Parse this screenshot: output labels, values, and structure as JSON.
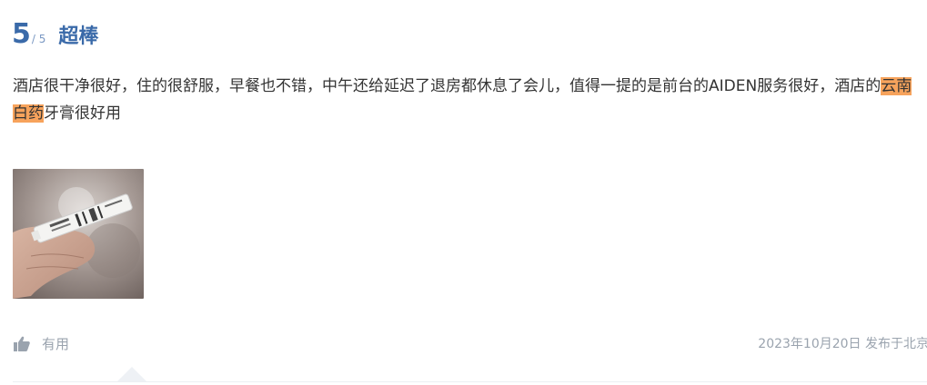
{
  "review": {
    "score": "5",
    "score_max": "/ 5",
    "title": "超棒",
    "text_before": "酒店很干净很好，住的很舒服，早餐也不错，中午还给延迟了退房都休息了会儿，值得一提的是前台的AIDEN服务很好，酒店的",
    "text_highlight": "云南白药",
    "text_after": "牙膏很好用",
    "photo_icon": "toothpaste-photo",
    "helpful_label": "有用",
    "helpful_icon": "thumbs-up-icon",
    "date_location": "2023年10月20日 发布于北京"
  },
  "colors": {
    "accent": "#3a6aa9",
    "highlight": "#f7a35c",
    "muted": "#9aa3ae"
  }
}
